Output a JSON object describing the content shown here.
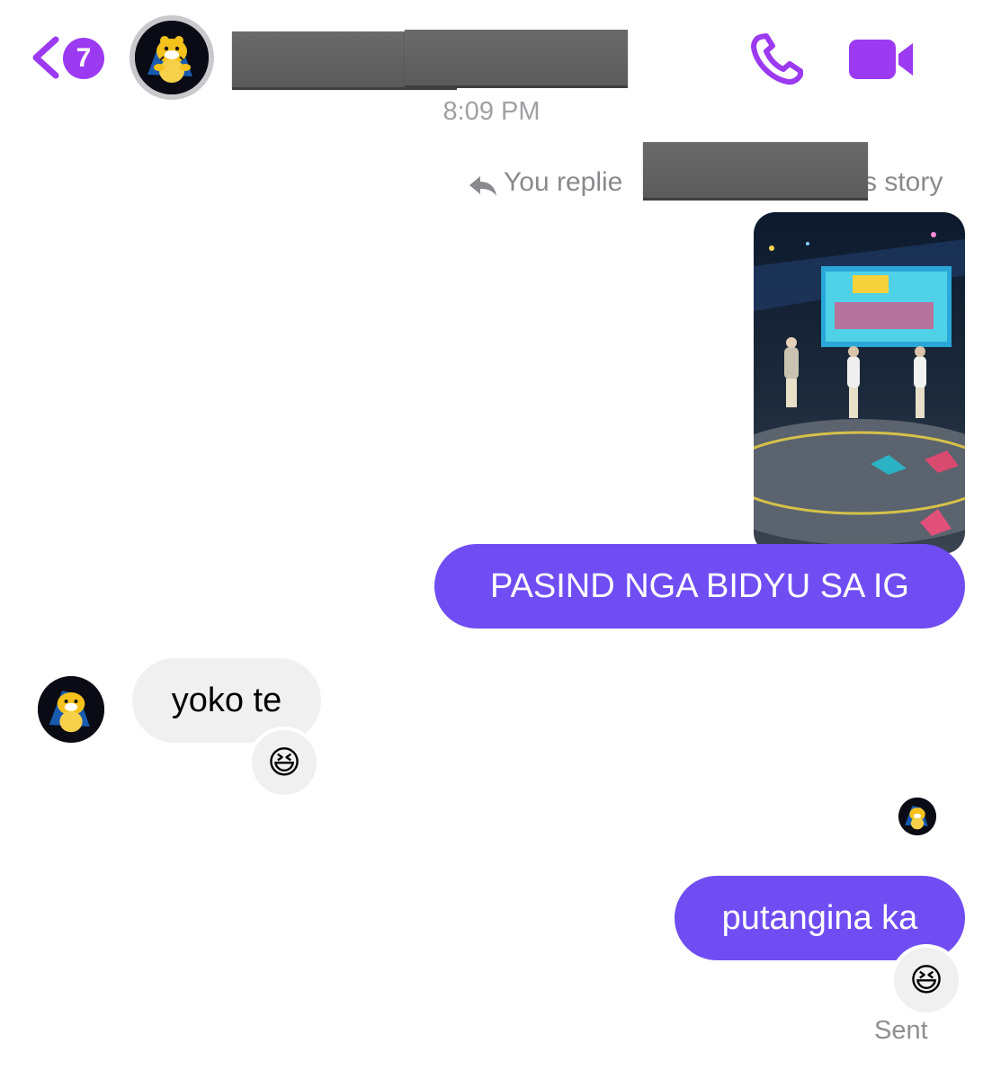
{
  "header": {
    "unread_count": "7",
    "contact_avatar": "tiger-plush-avatar",
    "call_icon": "phone-icon",
    "video_icon": "video-camera-icon",
    "accent_color": "#9b3af0"
  },
  "thread": {
    "timestamp": "8:09 PM",
    "reply_note_prefix": "You replie",
    "reply_note_suffix": "s story",
    "messages": [
      {
        "from": "me",
        "text": "PASIND NGA BIDYU SA IG"
      },
      {
        "from": "them",
        "text": "yoko te",
        "reaction": "😆"
      },
      {
        "from": "me",
        "text": "putangina ka",
        "reaction": "😆"
      }
    ],
    "status": "Sent"
  },
  "colors": {
    "outgoing_bubble": "#6f4df2",
    "incoming_bubble": "#f0f0f0"
  }
}
